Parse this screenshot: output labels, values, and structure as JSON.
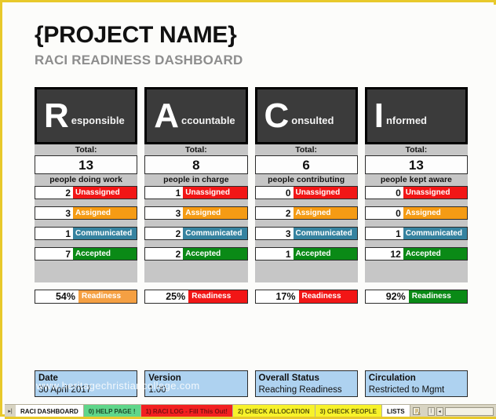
{
  "header": {
    "project_title": "{PROJECT NAME}",
    "subtitle": "RACI READINESS DASHBOARD"
  },
  "watermark": "www.heritagechristiancollege.com",
  "colors": {
    "unassigned": "#f21616",
    "assigned": "#f59b14",
    "communicated": "#3683a0",
    "accepted": "#0a8a16",
    "readiness_low": "#f21616",
    "readiness_mid": "#f5a043",
    "readiness_high": "#0a8a16",
    "header_box": "#3b3b3b",
    "gray_strip": "#c6c6c6",
    "info_box": "#aed2f0",
    "frame": "#e8c92a"
  },
  "labels": {
    "total": "Total:",
    "unassigned": "Unassigned",
    "assigned": "Assigned",
    "communicated": "Communicated",
    "accepted": "Accepted",
    "readiness": "Readiness"
  },
  "columns": [
    {
      "initial": "R",
      "rest": "esponsible",
      "total": "13",
      "caption": "people doing work",
      "unassigned": "2",
      "assigned": "3",
      "communicated": "1",
      "accepted": "7",
      "readiness": "54%",
      "readiness_color": "#f5a043"
    },
    {
      "initial": "A",
      "rest": "ccountable",
      "total": "8",
      "caption": "people in charge",
      "unassigned": "1",
      "assigned": "3",
      "communicated": "2",
      "accepted": "2",
      "readiness": "25%",
      "readiness_color": "#f21616"
    },
    {
      "initial": "C",
      "rest": "onsulted",
      "total": "6",
      "caption": "people contributing",
      "unassigned": "0",
      "assigned": "2",
      "communicated": "3",
      "accepted": "1",
      "readiness": "17%",
      "readiness_color": "#f21616"
    },
    {
      "initial": "I",
      "rest": "nformed",
      "total": "13",
      "caption": "people kept aware",
      "unassigned": "0",
      "assigned": "0",
      "communicated": "1",
      "accepted": "12",
      "readiness": "92%",
      "readiness_color": "#0a8a16"
    }
  ],
  "info_boxes": [
    {
      "title": "Date",
      "value": "30 April 2017"
    },
    {
      "title": "Version",
      "value": "1.00"
    },
    {
      "title": "Overall Status",
      "value": "Reaching Readiness"
    },
    {
      "title": "Circulation",
      "value": "Restricted to Mgmt"
    }
  ],
  "tabs": [
    {
      "label": "RACI DASHBOARD",
      "bg": "#ffffff",
      "fg": "#111111",
      "active": true
    },
    {
      "label": "0) HELP PAGE !",
      "bg": "#5fd68a",
      "fg": "#1c4a2a",
      "active": false
    },
    {
      "label": "1) RACI LOG - Fill This Out!",
      "bg": "#f22020",
      "fg": "#7a1010",
      "active": false
    },
    {
      "label": "2) CHECK ALLOCATION",
      "bg": "#f7f22a",
      "fg": "#5a5608",
      "active": false
    },
    {
      "label": "3) CHECK PEOPLE",
      "bg": "#f7f22a",
      "fg": "#5a5608",
      "active": false
    },
    {
      "label": "LISTS",
      "bg": "#ffffff",
      "fg": "#111111",
      "active": false
    }
  ],
  "tabbar": {
    "nav_arrows": "▸|",
    "new_sheet_icon": "new-sheet-icon",
    "scroll_left": "◂",
    "scroll_split": "|"
  }
}
